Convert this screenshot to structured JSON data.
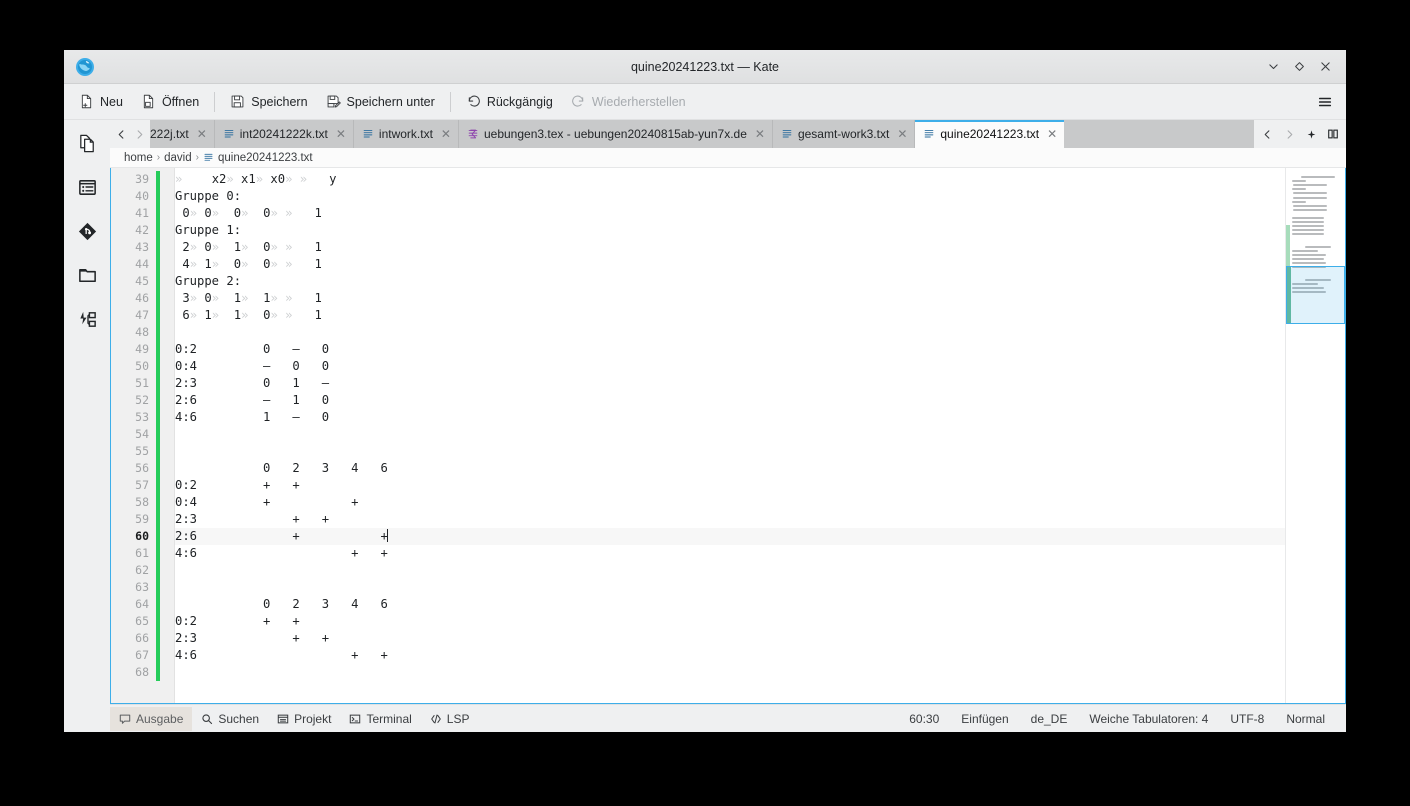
{
  "window": {
    "title": "quine20241223.txt — Kate",
    "app_icon": "kate-app-icon",
    "controls": {
      "minimize": "▾",
      "maximize": "◇",
      "close": "✕"
    }
  },
  "toolbar": {
    "items": [
      {
        "label": "Neu",
        "icon": "new-file-icon",
        "disabled": false
      },
      {
        "label": "Öffnen",
        "icon": "open-file-icon",
        "disabled": false
      },
      {
        "label": "Speichern",
        "icon": "save-icon",
        "disabled": false
      },
      {
        "label": "Speichern unter",
        "icon": "save-as-icon",
        "disabled": false
      },
      {
        "label": "Rückgängig",
        "icon": "undo-icon",
        "disabled": false
      },
      {
        "label": "Wiederherstellen",
        "icon": "redo-icon",
        "disabled": true
      }
    ],
    "menu_label": "hamburger-menu"
  },
  "sidebar": {
    "items": [
      {
        "name": "documents",
        "icon": "documents-icon"
      },
      {
        "name": "outline",
        "icon": "outline-list-icon"
      },
      {
        "name": "git",
        "icon": "git-icon"
      },
      {
        "name": "filesystem",
        "icon": "folder-icon"
      },
      {
        "name": "lsp-symbols",
        "icon": "lsp-symbols-icon"
      }
    ]
  },
  "tabbar": {
    "prev_label": "‹",
    "next_label": "›",
    "tabs": [
      {
        "label": "222j.txt",
        "icon": "text-file-icon",
        "active": false,
        "clipped": true
      },
      {
        "label": "int20241222k.txt",
        "icon": "text-file-icon",
        "active": false,
        "clipped": false
      },
      {
        "label": "intwork.txt",
        "icon": "text-file-icon",
        "active": false,
        "clipped": false
      },
      {
        "label": "uebungen3.tex - uebungen20240815ab-yun7x.de",
        "icon": "tex-file-icon",
        "active": false,
        "clipped": false
      },
      {
        "label": "gesamt-work3.txt",
        "icon": "text-file-icon",
        "active": false,
        "clipped": false
      },
      {
        "label": "quine20241223.txt",
        "icon": "text-file-icon",
        "active": true,
        "clipped": false
      }
    ],
    "close_label": "✕",
    "tools": [
      {
        "name": "tab-prev",
        "glyph": "‹"
      },
      {
        "name": "tab-next",
        "glyph": "›"
      },
      {
        "name": "quick-open",
        "glyph": "✦"
      },
      {
        "name": "split-view",
        "glyph": "▯▯"
      }
    ]
  },
  "breadcrumb": {
    "parts": [
      "home",
      "david",
      "quine20241223.txt"
    ],
    "separator": "›",
    "file_icon": "text-file-icon"
  },
  "editor": {
    "first_line": 39,
    "current_line": 60,
    "lines": [
      {
        "n": 39,
        "text": "\t    x2\t x1\t x0\t \t   y"
      },
      {
        "n": 40,
        "text": "Gruppe 0:"
      },
      {
        "n": 41,
        "text": " 0\t 0\t  0\t  0\t \t   1"
      },
      {
        "n": 42,
        "text": "Gruppe 1:"
      },
      {
        "n": 43,
        "text": " 2\t 0\t  1\t  0\t \t   1"
      },
      {
        "n": 44,
        "text": " 4\t 1\t  0\t  0\t \t   1"
      },
      {
        "n": 45,
        "text": "Gruppe 2:"
      },
      {
        "n": 46,
        "text": " 3\t 0\t  1\t  1\t \t   1"
      },
      {
        "n": 47,
        "text": " 6\t 1\t  1\t  0\t \t   1"
      },
      {
        "n": 48,
        "text": ""
      },
      {
        "n": 49,
        "text": "0:2         0   –   0"
      },
      {
        "n": 50,
        "text": "0:4         –   0   0"
      },
      {
        "n": 51,
        "text": "2:3         0   1   –"
      },
      {
        "n": 52,
        "text": "2:6         –   1   0"
      },
      {
        "n": 53,
        "text": "4:6         1   –   0"
      },
      {
        "n": 54,
        "text": ""
      },
      {
        "n": 55,
        "text": ""
      },
      {
        "n": 56,
        "text": "            0   2   3   4   6"
      },
      {
        "n": 57,
        "text": "0:2         +   +"
      },
      {
        "n": 58,
        "text": "0:4         +           +"
      },
      {
        "n": 59,
        "text": "2:3             +   +"
      },
      {
        "n": 60,
        "text": "2:6             +           +"
      },
      {
        "n": 61,
        "text": "4:6                     +   +"
      },
      {
        "n": 62,
        "text": ""
      },
      {
        "n": 63,
        "text": ""
      },
      {
        "n": 64,
        "text": "            0   2   3   4   6"
      },
      {
        "n": 65,
        "text": "0:2         +   +"
      },
      {
        "n": 66,
        "text": "2:3             +   +"
      },
      {
        "n": 67,
        "text": "4:6                     +   +"
      },
      {
        "n": 68,
        "text": ""
      }
    ],
    "tab_marker": "»"
  },
  "statusbar": {
    "left": [
      {
        "label": "Ausgabe",
        "icon": "output-panel-icon",
        "selected": true
      },
      {
        "label": "Suchen",
        "icon": "search-icon",
        "selected": false
      },
      {
        "label": "Projekt",
        "icon": "project-icon",
        "selected": false
      },
      {
        "label": "Terminal",
        "icon": "terminal-icon",
        "selected": false
      },
      {
        "label": "LSP",
        "icon": "code-brackets-icon",
        "selected": false
      }
    ],
    "right": [
      {
        "name": "cursor-position",
        "label": "60:30"
      },
      {
        "name": "input-mode",
        "label": "Einfügen"
      },
      {
        "name": "language-dictionary",
        "label": "de_DE"
      },
      {
        "name": "indentation",
        "label": "Weiche Tabulatoren: 4"
      },
      {
        "name": "encoding",
        "label": "UTF-8"
      },
      {
        "name": "highlight-mode",
        "label": "Normal"
      }
    ]
  },
  "colors": {
    "accent": "#3daee9",
    "chrome": "#eff0f1",
    "tab_inactive": "#c8c9ca",
    "editor_bg": "#ffffff",
    "marker_green": "#25cc5a",
    "text": "#232629"
  }
}
